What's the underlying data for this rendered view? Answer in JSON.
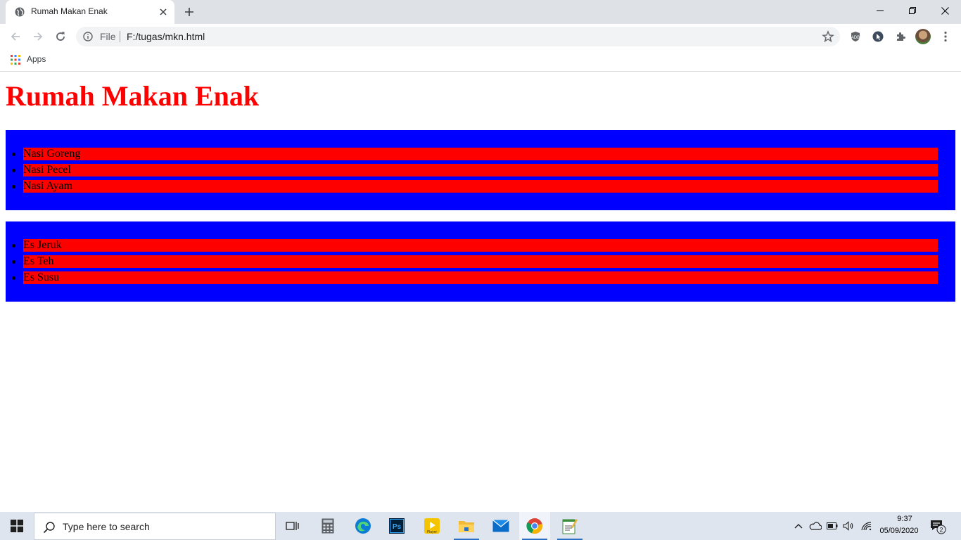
{
  "browser": {
    "tab_title": "Rumah Makan Enak",
    "address_scheme": "File",
    "address_url": "F:/tugas/mkn.html",
    "bookmarks": {
      "apps_label": "Apps"
    }
  },
  "page": {
    "heading": "Rumah Makan Enak",
    "food_menu": [
      "Nasi Goreng",
      "Nasi Pecel",
      "Nasi Ayam"
    ],
    "drink_menu": [
      "Es Jeruk",
      "Es Teh",
      "Es Susu"
    ],
    "colors": {
      "heading": "#ff0000",
      "box_background": "#0000ff",
      "item_background": "#ff0000"
    }
  },
  "taskbar": {
    "search_placeholder": "Type here to search",
    "clock_time": "9:37",
    "clock_date": "05/09/2020",
    "notification_count": "2",
    "apps": [
      "task-view",
      "calculator",
      "edge",
      "photoshop",
      "player",
      "file-explorer",
      "mail",
      "chrome",
      "notepad"
    ]
  }
}
